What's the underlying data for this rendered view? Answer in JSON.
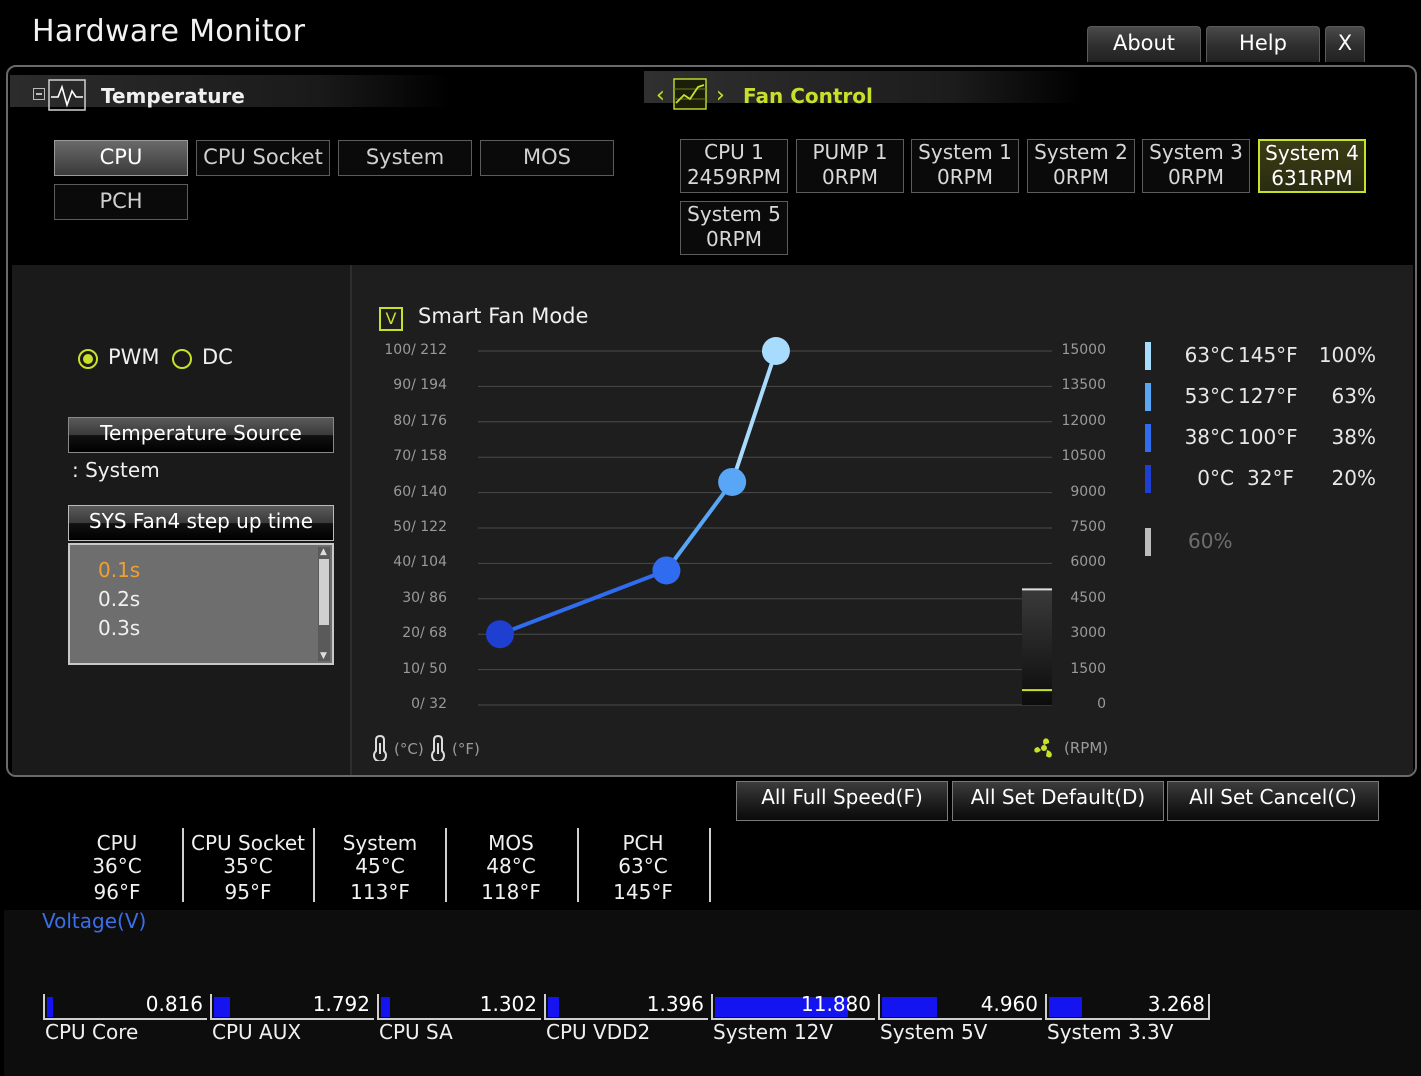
{
  "app": {
    "title": "Hardware Monitor"
  },
  "top_buttons": {
    "about": "About",
    "help": "Help",
    "close": "X"
  },
  "temperature_section": {
    "title": "Temperature"
  },
  "fan_section": {
    "title": "Fan Control",
    "prev": "‹",
    "next": "›"
  },
  "sensor_tabs": [
    {
      "label": "CPU",
      "selected": true
    },
    {
      "label": "CPU Socket",
      "selected": false
    },
    {
      "label": "System",
      "selected": false
    },
    {
      "label": "MOS",
      "selected": false
    },
    {
      "label": "PCH",
      "selected": false
    }
  ],
  "fans": [
    {
      "name": "CPU 1",
      "rpm": "2459RPM",
      "selected": false
    },
    {
      "name": "PUMP 1",
      "rpm": "0RPM",
      "selected": false
    },
    {
      "name": "System 1",
      "rpm": "0RPM",
      "selected": false
    },
    {
      "name": "System 2",
      "rpm": "0RPM",
      "selected": false
    },
    {
      "name": "System 3",
      "rpm": "0RPM",
      "selected": false
    },
    {
      "name": "System 4",
      "rpm": "631RPM",
      "selected": true
    },
    {
      "name": "System 5",
      "rpm": "0RPM",
      "selected": false
    }
  ],
  "mode": {
    "pwm": "PWM",
    "dc": "DC",
    "selected": "PWM"
  },
  "temp_source": {
    "button": "Temperature Source",
    "value": ": System"
  },
  "step_up": {
    "button": "SYS Fan4 step up time",
    "options": [
      "0.1s",
      "0.2s",
      "0.3s"
    ],
    "selected": "0.1s"
  },
  "smart_fan": {
    "checkbox": "V",
    "label": "Smart Fan Mode",
    "checked": true
  },
  "chart_data": {
    "type": "line",
    "left_axis_ticks": [
      "100/ 212",
      "90/ 194",
      "80/ 176",
      "70/ 158",
      "60/ 140",
      "50/ 122",
      "40/ 104",
      "30/  86",
      "20/  68",
      "10/  50",
      "0/  32"
    ],
    "right_axis_ticks": [
      "15000",
      "13500",
      "12000",
      "10500",
      "9000",
      "7500",
      "6000",
      "4500",
      "3000",
      "1500",
      "0"
    ],
    "left_unit_c": "(°C)",
    "left_unit_f": "(°F)",
    "right_unit": "(RPM)",
    "ylim": [
      0,
      100
    ],
    "points": [
      {
        "temp_c": 0,
        "percent": 20,
        "color": "#1e3fcf"
      },
      {
        "temp_c": 38,
        "percent": 38,
        "color": "#2f6cf0"
      },
      {
        "temp_c": 53,
        "percent": 63,
        "color": "#58a6f5"
      },
      {
        "temp_c": 63,
        "percent": 100,
        "color": "#a8dcff"
      }
    ],
    "current_rpm": 631,
    "gauge_max_rpm": 4900
  },
  "legend": [
    {
      "c": "63°C",
      "f": "145°F",
      "pct": "100%",
      "color": "#a8dcff"
    },
    {
      "c": "53°C",
      "f": "127°F",
      "pct": "63%",
      "color": "#58a6f5"
    },
    {
      "c": "38°C",
      "f": "100°F",
      "pct": "38%",
      "color": "#2f6cf0"
    },
    {
      "c": "0°C",
      "f": "32°F",
      "pct": "20%",
      "color": "#1e3fcf"
    }
  ],
  "legend_extra": {
    "pct": "60%",
    "color": "#bdbdbd"
  },
  "actions": {
    "full_speed": "All Full Speed(F)",
    "set_default": "All Set Default(D)",
    "set_cancel": "All Set Cancel(C)"
  },
  "temperatures": [
    {
      "name": "CPU",
      "c": "36°C",
      "f": "96°F"
    },
    {
      "name": "CPU Socket",
      "c": "35°C",
      "f": "95°F"
    },
    {
      "name": "System",
      "c": "45°C",
      "f": "113°F"
    },
    {
      "name": "MOS",
      "c": "48°C",
      "f": "118°F"
    },
    {
      "name": "PCH",
      "c": "63°C",
      "f": "145°F"
    }
  ],
  "voltage": {
    "title": "Voltage(V)",
    "items": [
      {
        "label": "CPU Core",
        "value": "0.816",
        "fill_fraction": 0.03
      },
      {
        "label": "CPU AUX",
        "value": "1.792",
        "fill_fraction": 0.1
      },
      {
        "label": "CPU SA",
        "value": "1.302",
        "fill_fraction": 0.06
      },
      {
        "label": "CPU VDD2",
        "value": "1.396",
        "fill_fraction": 0.07
      },
      {
        "label": "System 12V",
        "value": "11.880",
        "fill_fraction": 0.85
      },
      {
        "label": "System 5V",
        "value": "4.960",
        "fill_fraction": 0.35
      },
      {
        "label": "System 3.3V",
        "value": "3.268",
        "fill_fraction": 0.21
      }
    ]
  }
}
